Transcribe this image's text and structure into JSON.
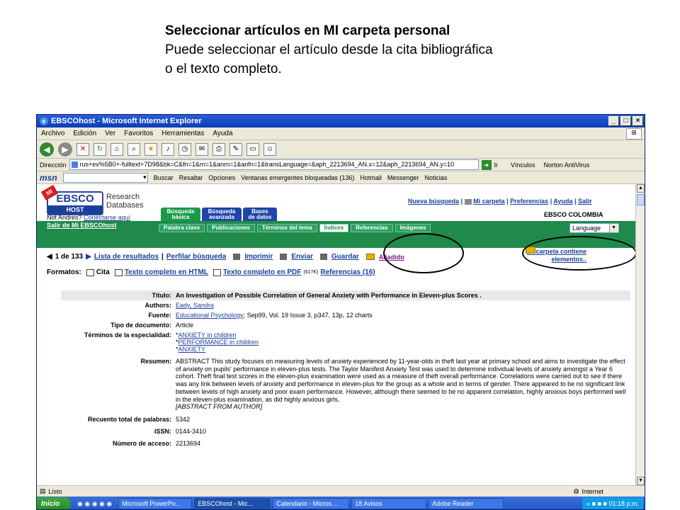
{
  "slide": {
    "heading": "Seleccionar artículos en MI carpeta personal",
    "line1": "Puede seleccionar el artículo desde la cita bibliográfica",
    "line2": "o el texto completo."
  },
  "browser": {
    "title": "EBSCOhost - Microsoft Internet Explorer",
    "menu": [
      "Archivo",
      "Edición",
      "Ver",
      "Favoritos",
      "Herramientas",
      "Ayuda"
    ],
    "address_label": "Dirección",
    "address_value": "rus+ex%5B0+-fulltext+7D98&bk=C&fn=1&rn=1&anrn=1&anfn=1&transLanguage=&aph_2213694_AN.x=12&aph_2213694_AN.y=10",
    "go_label": "Ir",
    "links_label": "Vínculos",
    "norton_label": "Norton AntiVirus",
    "msn": {
      "logo": "msn",
      "buscar": "Buscar",
      "resaltar": "Resaltar",
      "opciones": "Opciones",
      "popups": "Ventanas emergentes bloqueadas (136)",
      "hotmail": "Hotmail",
      "messenger": "Messenger",
      "noticias": "Noticias"
    },
    "status": "Listo",
    "zone": "Internet"
  },
  "ebsco": {
    "logo_top": "EBSCO",
    "logo_bottom": "HOST",
    "logo_badge": "MI",
    "research_line1": "Research",
    "research_line2": "Databases",
    "user_text": "Not Andres?",
    "user_link": "Conectarse aquí",
    "top_links": {
      "nueva": "Nueva búsqueda",
      "carpeta": "Mi carpeta",
      "preferencias": "Preferencias",
      "ayuda": "Ayuda",
      "salir": "Salir"
    },
    "country": "EBSCO COLOMBIA",
    "tabs": [
      {
        "line1": "Búsqueda",
        "line2": "básica"
      },
      {
        "line1": "Búsqueda",
        "line2": "avanzada"
      },
      {
        "line1": "Bases",
        "line2": "de datos"
      }
    ],
    "subtabs": [
      "Palabra clave",
      "Publicaciones",
      "Términos del tema",
      "Índices",
      "Referencias",
      "Imágenes"
    ],
    "exit_link": "Salir de Mi EBSCOhost",
    "language": "Language",
    "nav": {
      "position": "1 de 133",
      "results": "Lista de resultados",
      "refine": "Perfilar búsqueda",
      "print": "Imprimir",
      "send": "Enviar",
      "save": "Guardar",
      "added": "Añadido"
    },
    "folder_notice_line1": "Mi carpeta contiene",
    "folder_notice_line2": "elementos..",
    "formats": {
      "label": "Formatos:",
      "cita": "Cita",
      "html": "Texto completo en HTML",
      "pdf": "Texto completo en PDF",
      "pdf_size": "(617K)",
      "refs": "Referencias (16)"
    },
    "record": {
      "title_label": "Título:",
      "title": "An Investigation of Possible Correlation of General Anxiety with Performance in Eleven-plus Scores .",
      "authors_label": "Authors:",
      "authors": "Eady, Sandra",
      "source_label": "Fuente:",
      "source_link": "Educational Psychology",
      "source_rest": "; Sep99, Vol. 19 Issue 3, p347, 13p, 12 charts",
      "doctype_label": "Tipo de documento:",
      "doctype": "Article",
      "subjects_label": "Términos de la especialidad:",
      "subjects": [
        "ANXIETY in children",
        "PERFORMANCE in children",
        "ANXIETY"
      ],
      "abstract_label": "Resumen:",
      "abstract": "ABSTRACT This study focuses on measuring levels of anxiety experienced by 11-year-olds in theft last year at primary school and aims to investigate the effect of anxiety on pupils' performance in eleven-plus tests. The Taylor Manifest Anxiety Test was used to determine individual levels of anxiety amongst a Year 6 cohort. Theft final test scores in the eleven-plus examination were used as a measure of theft overall performance. Correlations were carried out to see if there was any link between levels of anxiety and performance in eleven-plus for the group as a whole and in terms of gender. There appeared to be no significant link between levels of high anxiety and poor exam performance. However, although there seemed to be no apparent correlation, highly anxious boys performed well in the eleven-plus examination, as did highly anxious girls.",
      "abstract_end": "[ABSTRACT FROM AUTHOR]",
      "words_label": "Recuento total de palabras:",
      "words": "5342",
      "issn_label": "ISSN:",
      "issn": "0144-3410",
      "access_label": "Número de acceso:",
      "access": "2213694"
    }
  },
  "taskbar": {
    "start": "Inicio",
    "items": [
      "Microsoft PowerPo...",
      "EBSCOhost - Mic...",
      "Calendario - Micros...",
      "18 Avisos",
      "Adobe Reader"
    ],
    "clock": "01:18 p.m."
  }
}
